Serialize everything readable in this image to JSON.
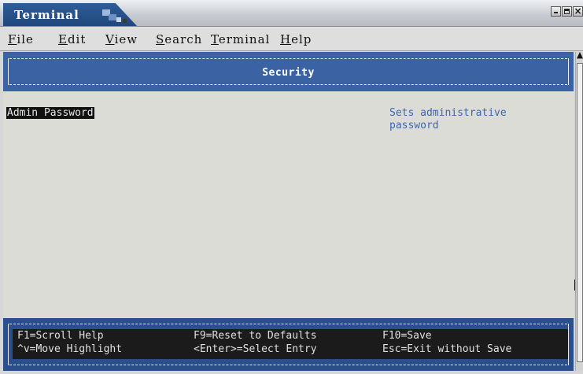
{
  "window": {
    "title": "Terminal",
    "close_glyph": "×",
    "icons": [
      "terminal-app-icon",
      "minimize-icon",
      "maximize-icon",
      "close-icon"
    ]
  },
  "menu": {
    "items": [
      {
        "accel": "F",
        "rest": "ile"
      },
      {
        "accel": "E",
        "rest": "dit"
      },
      {
        "accel": "V",
        "rest": "iew"
      },
      {
        "accel": "S",
        "rest": "earch"
      },
      {
        "accel": "T",
        "rest": "erminal"
      },
      {
        "accel": "H",
        "rest": "elp"
      }
    ]
  },
  "screen": {
    "title": "Security",
    "selected_item": "Admin Password",
    "help_text": "Sets administrative\npassword"
  },
  "footer": {
    "col1": [
      "F1=Scroll Help",
      "^v=Move Highlight"
    ],
    "col2": [
      "F9=Reset to Defaults",
      "<Enter>=Select Entry"
    ],
    "col3": [
      "F10=Save",
      "Esc=Exit without Save"
    ]
  },
  "colors": {
    "header_blue": "#3b63a4",
    "footer_blue": "#2b4f8c",
    "help_text_blue": "#3c66b2",
    "terminal_bg": "#dcdcd7"
  }
}
